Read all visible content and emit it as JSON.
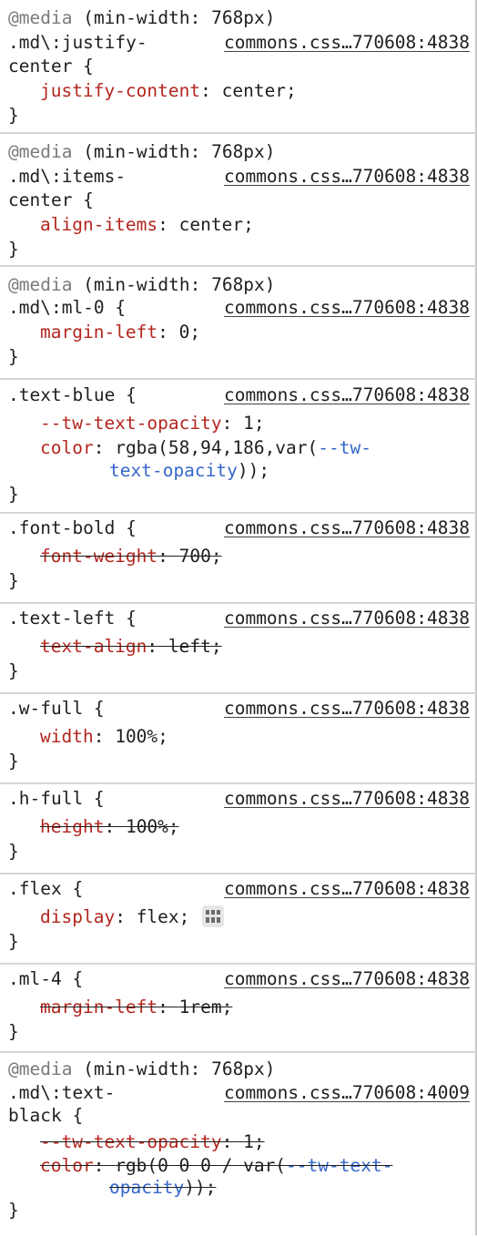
{
  "media_query": "(min-width: 768px)",
  "media_keyword": "@media",
  "rules": [
    {
      "id": "justify-center",
      "selector1": ".md\\:justify-",
      "selector2": "center {",
      "source": "commons.css…770608:4838",
      "decls": [
        {
          "prop": "justify-content",
          "value": "center;",
          "struck": false
        }
      ]
    },
    {
      "id": "items-center",
      "selector1": ".md\\:items-",
      "selector2": "center {",
      "source": "commons.css…770608:4838",
      "decls": [
        {
          "prop": "align-items",
          "value": "center;",
          "struck": false
        }
      ]
    },
    {
      "id": "ml-0",
      "selector1": ".md\\:ml-0 {",
      "source": "commons.css…770608:4838",
      "decls": [
        {
          "prop": "margin-left",
          "value": "0;",
          "struck": false
        }
      ]
    },
    {
      "id": "text-blue",
      "selector1": ".text-blue {",
      "source": "commons.css…770608:4838",
      "decls": [
        {
          "prop": "--tw-text-opacity",
          "value": "1;",
          "struck": false
        },
        {
          "prop": "color",
          "value": "rgba(58,94,186,var(",
          "var1": "--tw-",
          "var2": "text-opacity",
          "tail": "));"
        }
      ]
    },
    {
      "id": "font-bold",
      "selector1": ".font-bold {",
      "source": "commons.css…770608:4838",
      "decls": [
        {
          "prop": "font-weight",
          "value": "700;",
          "struck": true
        }
      ]
    },
    {
      "id": "text-left",
      "selector1": ".text-left {",
      "source": "commons.css…770608:4838",
      "decls": [
        {
          "prop": "text-align",
          "value": "left;",
          "struck": true
        }
      ]
    },
    {
      "id": "w-full",
      "selector1": ".w-full {",
      "source": "commons.css…770608:4838",
      "decls": [
        {
          "prop": "width",
          "value": "100%;",
          "struck": false
        }
      ]
    },
    {
      "id": "h-full",
      "selector1": ".h-full {",
      "source": "commons.css…770608:4838",
      "decls": [
        {
          "prop": "height",
          "value": "100%;",
          "struck": true
        }
      ]
    },
    {
      "id": "flex",
      "selector1": ".flex {",
      "source": "commons.css…770608:4838",
      "decls": [
        {
          "prop": "display",
          "value": "flex;",
          "struck": false,
          "badge": "flexbox-editor-icon"
        }
      ]
    },
    {
      "id": "ml-4",
      "selector1": ".ml-4 {",
      "source": "commons.css…770608:4838",
      "decls": [
        {
          "prop": "margin-left",
          "value": "1rem;",
          "struck": true
        }
      ]
    },
    {
      "id": "text-black",
      "selector1": ".md\\:text-",
      "selector2": "black {",
      "source": "commons.css…770608:4009",
      "decls": [
        {
          "prop": "--tw-text-opacity",
          "value": "1;",
          "struck": true
        },
        {
          "prop": "color",
          "value": "rgb(0 0 0 / var(",
          "var1": "--tw-text-",
          "var2": "opacity",
          "tail": "));"
        }
      ]
    }
  ],
  "close_brace": "}",
  "colon": ":"
}
